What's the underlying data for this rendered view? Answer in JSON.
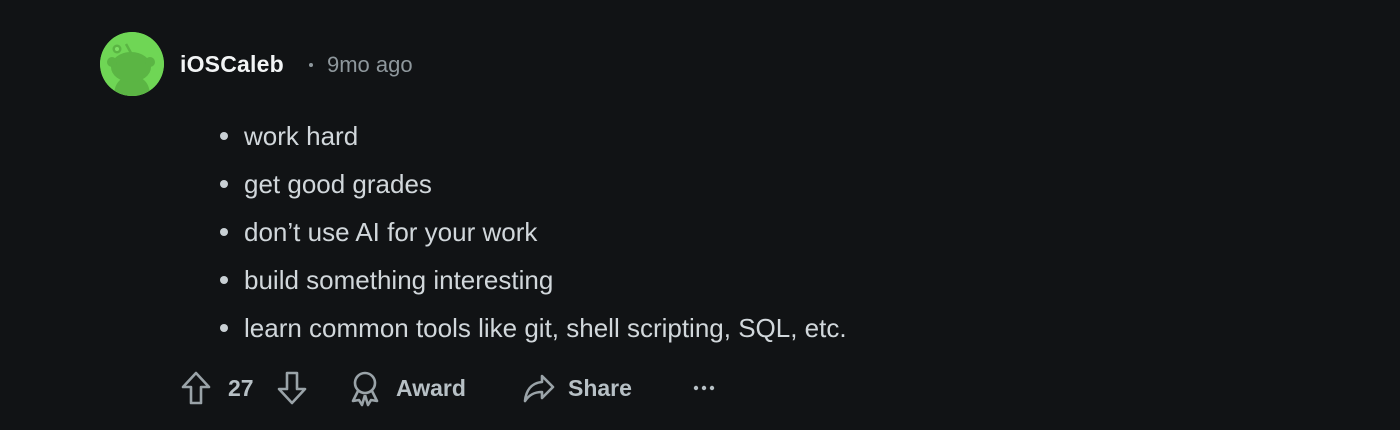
{
  "comment": {
    "author": "iOSCaleb",
    "separator": "•",
    "timestamp": "9mo ago",
    "avatar_icon": "reddit-snoo-avatar-icon",
    "avatar_color": "#6fd655",
    "body_items": [
      "work hard",
      "get good grades",
      "don’t use AI for your work",
      "build something interesting",
      "learn common tools like git, shell scripting, SQL, etc."
    ]
  },
  "actions": {
    "upvote_icon": "upvote-arrow-icon",
    "score": "27",
    "downvote_icon": "downvote-arrow-icon",
    "award_icon": "award-icon",
    "award_label": "Award",
    "share_icon": "share-arrow-icon",
    "share_label": "Share",
    "more_icon": "more-options-icon",
    "more_label": "···"
  },
  "theme": {
    "background": "#111315",
    "text": "#d7dadc",
    "muted": "#8e979c"
  }
}
